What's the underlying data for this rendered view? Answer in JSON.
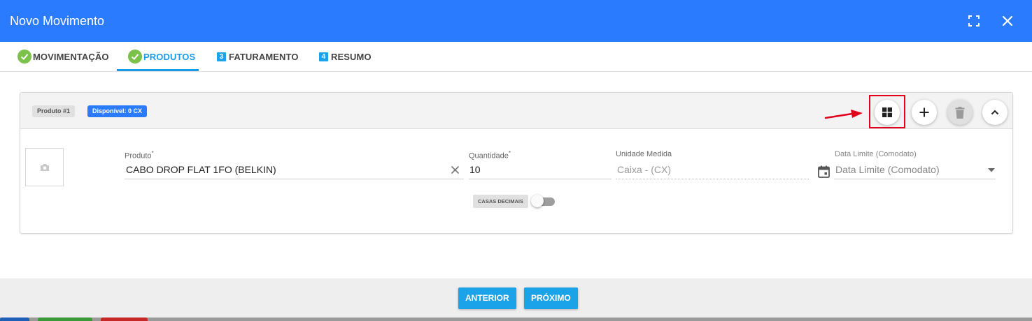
{
  "window": {
    "title": "Novo Movimento",
    "expand_icon": "fullscreen-icon",
    "close_icon": "close-icon"
  },
  "tabs": [
    {
      "label": "MOVIMENTAÇÃO",
      "marker": "check",
      "active": false
    },
    {
      "label": "PRODUTOS",
      "marker": "check",
      "active": true
    },
    {
      "label": "FATURAMENTO",
      "marker": "3",
      "active": false
    },
    {
      "label": "RESUMO",
      "marker": "4",
      "active": false
    }
  ],
  "product_card": {
    "badge": "Produto #1",
    "available_badge": "Disponível: 0 CX",
    "actions": [
      "grid-view-icon",
      "add-icon",
      "trash-icon",
      "chevron-up-icon"
    ],
    "photo_icon": "camera-icon",
    "fields": {
      "produto": {
        "label": "Produto",
        "required": "*",
        "value": "CABO DROP FLAT 1FO (BELKIN)"
      },
      "quantidade": {
        "label": "Quantidade",
        "required": "*",
        "value": "10"
      },
      "unidade": {
        "label": "Unidade Medida",
        "value": "Caixa - (CX)"
      },
      "data_limite": {
        "label": "Data Limite (Comodato)",
        "placeholder": "Data Limite (Comodato)"
      }
    },
    "casas_decimais": {
      "label": "CASAS DECIMAIS",
      "enabled": false
    }
  },
  "footer": {
    "prev_label": "ANTERIOR",
    "next_label": "PRÓXIMO"
  },
  "colors": {
    "header": "#2b7bff",
    "accent": "#1aa3e8",
    "success": "#7cc24a",
    "highlight": "#e3001b"
  }
}
